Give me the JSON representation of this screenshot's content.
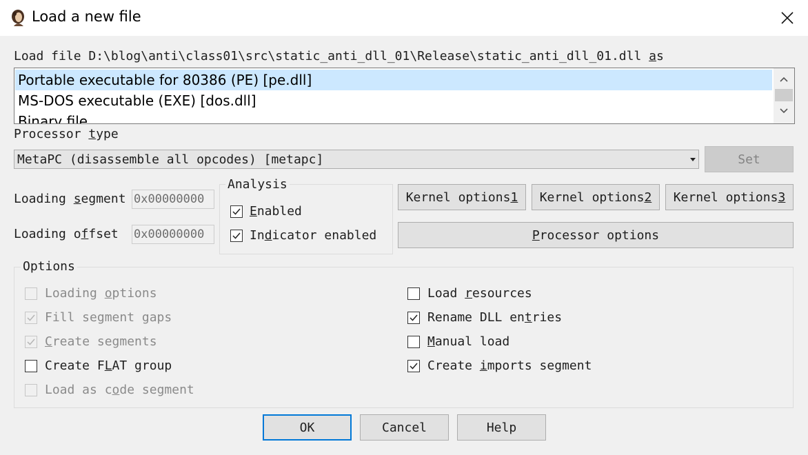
{
  "window": {
    "title": "Load a new file",
    "close_icon": "close-icon",
    "app_icon": "ida-portrait-icon"
  },
  "load_file": {
    "prefix": "Load file D:\\blog\\anti\\class01\\src\\static_anti_dll_01\\Release\\static_anti_dll_01.dll ",
    "as_a": "a",
    "as_s": "s"
  },
  "file_types": [
    {
      "label": "Portable executable for 80386 (PE) [pe.dll]",
      "selected": true
    },
    {
      "label": "MS-DOS executable (EXE) [dos.dll]",
      "selected": false
    },
    {
      "label": "Binary file",
      "selected": false
    }
  ],
  "processor": {
    "label_pre": "Processor ",
    "label_u": "t",
    "label_post": "ype",
    "selected": "MetaPC (disassemble all opcodes) [metapc]",
    "set_button": "Set"
  },
  "loading": {
    "segment_pre": "Loading ",
    "segment_u": "s",
    "segment_post": "egment",
    "segment_value": "0x00000000",
    "offset_pre": "Loading o",
    "offset_u": "f",
    "offset_post": "fset",
    "offset_value": "0x00000000"
  },
  "analysis": {
    "title": "Analysis",
    "enabled_u": "E",
    "enabled_post": "nabled",
    "indicator_pre": "In",
    "indicator_u": "d",
    "indicator_post": "icator enabled",
    "enabled_checked": true,
    "indicator_checked": true
  },
  "kernel_buttons": [
    {
      "pre": "Kernel options ",
      "u": "1"
    },
    {
      "pre": "Kernel options ",
      "u": "2"
    },
    {
      "pre": "Kernel options ",
      "u": "3"
    }
  ],
  "processor_options": {
    "u": "P",
    "post": "rocessor options"
  },
  "options": {
    "title": "Options",
    "left": [
      {
        "pre": "Loading ",
        "u": "o",
        "post": "ptions",
        "checked": false,
        "disabled": true
      },
      {
        "pre": "Fill segment gaps",
        "u": "",
        "post": "",
        "checked": true,
        "disabled": true
      },
      {
        "pre": "",
        "u": "C",
        "post": "reate segments",
        "checked": true,
        "disabled": true
      },
      {
        "pre": "Create F",
        "u": "L",
        "post": "AT group",
        "checked": false,
        "disabled": false
      },
      {
        "pre": "Load as c",
        "u": "o",
        "post": "de segment",
        "checked": false,
        "disabled": true
      }
    ],
    "right": [
      {
        "pre": "Load ",
        "u": "r",
        "post": "esources",
        "checked": false,
        "disabled": false
      },
      {
        "pre": "Rename DLL en",
        "u": "t",
        "post": "ries",
        "checked": true,
        "disabled": false
      },
      {
        "pre": "",
        "u": "M",
        "post": "anual load",
        "checked": false,
        "disabled": false
      },
      {
        "pre": "Create ",
        "u": "i",
        "post": "mports segment",
        "checked": true,
        "disabled": false
      }
    ]
  },
  "buttons": {
    "ok": "OK",
    "cancel": "Cancel",
    "help": "Help"
  }
}
